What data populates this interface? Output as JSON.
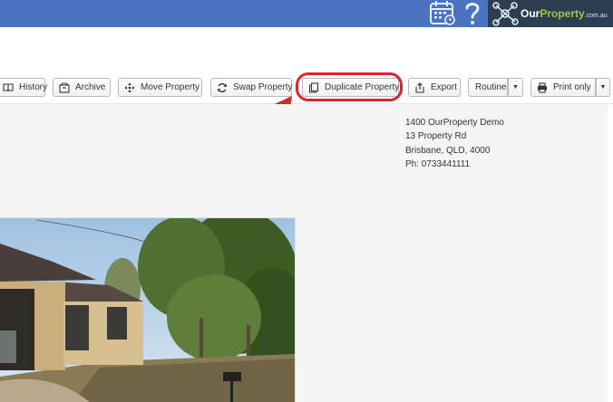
{
  "header": {
    "logo": {
      "name_primary": "Our",
      "name_highlight": "Property",
      "domain_suffix": ".com.au"
    },
    "icons": [
      "calendar-icon",
      "help-icon"
    ],
    "colors": {
      "bar": "#4a73c0",
      "logo_bg": "#2c3f52",
      "logo_accent": "#9cc93a"
    }
  },
  "toolbar": {
    "history_label": "History",
    "archive_label": "Archive",
    "move_label": "Move Property",
    "swap_label": "Swap Property",
    "duplicate_label": "Duplicate Property",
    "export_label": "Export",
    "routine_label": "Routine",
    "print_label": "Print only"
  },
  "annotation": {
    "highlight_color": "#d8262c",
    "target": "Duplicate Property"
  },
  "agency": {
    "line1": "1400 OurProperty Demo",
    "line2": "13 Property Rd",
    "line3": "Brisbane, QLD, 4000",
    "phone": "Ph: 0733441111"
  },
  "property_photo": {
    "subject": "house-exterior-photo"
  }
}
